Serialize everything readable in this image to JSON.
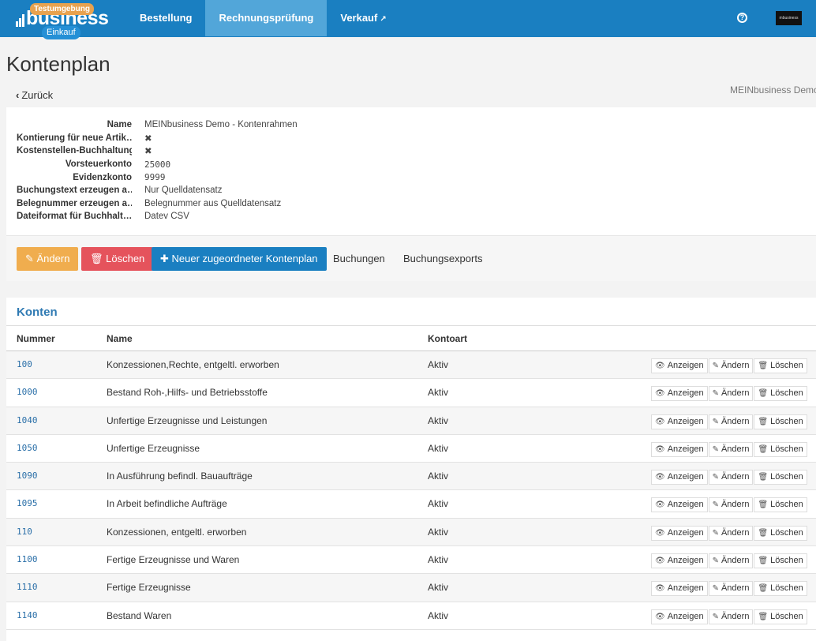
{
  "topbar": {
    "logo_text": "business",
    "env_badge": "Testumgebung",
    "module_badge": "Einkauf",
    "nav": [
      {
        "label": "Bestellung",
        "active": false
      },
      {
        "label": "Rechnungsprüfung",
        "active": true
      },
      {
        "label": "Verkauf",
        "active": false,
        "external": true
      }
    ],
    "help_icon": "help-circle-icon",
    "avatar_text": "mbusiness"
  },
  "page": {
    "title": "Kontenplan",
    "back_label": "Zurück",
    "tenant": "MEINbusiness Demo"
  },
  "details": {
    "fields": [
      {
        "label": "Name",
        "value": "MEINbusiness Demo - Kontenrahmen"
      },
      {
        "label": "Kontierung für neue Artik…",
        "value": "✖"
      },
      {
        "label": "Kostenstellen-Buchhaltung",
        "value": "✖"
      },
      {
        "label": "Vorsteuerkonto",
        "value": "25000"
      },
      {
        "label": "Evidenzkonto",
        "value": "9999"
      },
      {
        "label": "Buchungstext erzeugen a…",
        "value": "Nur Quelldatensatz"
      },
      {
        "label": "Belegnummer erzeugen a…",
        "value": "Belegnummer aus Quelldatensatz"
      },
      {
        "label": "Dateiformat für Buchhalt…",
        "value": "Datev CSV"
      }
    ],
    "buttons": {
      "edit": "Ändern",
      "delete": "Löschen",
      "new_plan": "Neuer zugeordneter Kontenplan",
      "bookings": "Buchungen",
      "exports": "Buchungsexports"
    }
  },
  "konten": {
    "title": "Konten",
    "columns": [
      "Nummer",
      "Name",
      "Kontoart"
    ],
    "action_labels": {
      "view": "Anzeigen",
      "edit": "Ändern",
      "delete": "Löschen"
    },
    "rows": [
      {
        "nummer": "100",
        "name": "Konzessionen,Rechte, entgeltl. erworben",
        "kontoart": "Aktiv"
      },
      {
        "nummer": "1000",
        "name": "Bestand Roh-,Hilfs- und Betriebsstoffe",
        "kontoart": "Aktiv"
      },
      {
        "nummer": "1040",
        "name": "Unfertige Erzeugnisse und Leistungen",
        "kontoart": "Aktiv"
      },
      {
        "nummer": "1050",
        "name": "Unfertige Erzeugnisse",
        "kontoart": "Aktiv"
      },
      {
        "nummer": "1090",
        "name": "In Ausführung befindl. Bauaufträge",
        "kontoart": "Aktiv"
      },
      {
        "nummer": "1095",
        "name": "In Arbeit befindliche Aufträge",
        "kontoart": "Aktiv"
      },
      {
        "nummer": "110",
        "name": "Konzessionen, entgeltl. erworben",
        "kontoart": "Aktiv"
      },
      {
        "nummer": "1100",
        "name": "Fertige Erzeugnisse und Waren",
        "kontoart": "Aktiv"
      },
      {
        "nummer": "1110",
        "name": "Fertige Erzeugnisse",
        "kontoart": "Aktiv"
      },
      {
        "nummer": "1140",
        "name": "Bestand Waren",
        "kontoart": "Aktiv"
      }
    ]
  },
  "colors": {
    "topbar": "#1a7fc1",
    "nav_active": "#52a6d9",
    "warning": "#f0ad4e",
    "danger": "#e5535c",
    "primary": "#1a7fc1",
    "link": "#2a6fa8"
  }
}
